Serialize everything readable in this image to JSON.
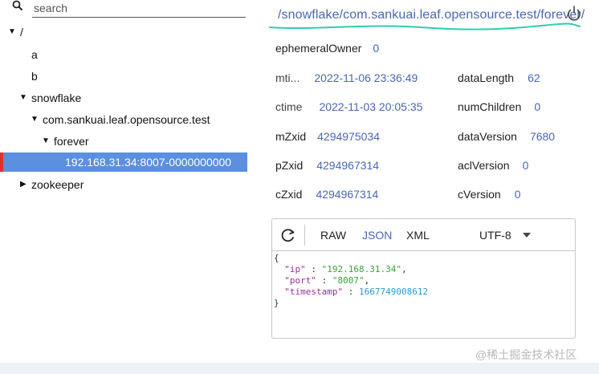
{
  "search": {
    "placeholder": "search"
  },
  "tree": {
    "root": "/",
    "a": "a",
    "b": "b",
    "snowflake": "snowflake",
    "com": "com.sankuai.leaf.opensource.test",
    "forever": "forever",
    "selected_node": "192.168.31.34:8007-0000000000",
    "zookeeper": "zookeeper"
  },
  "path": "/snowflake/com.sankuai.leaf.opensource.test/forever/",
  "props": {
    "ephemeralOwner": {
      "key": "ephemeralOwner",
      "value": "0"
    },
    "mtime": {
      "key": "mti...",
      "value": "2022-11-06 23:36:49"
    },
    "ctime": {
      "key": "ctime",
      "value": "2022-11-03 20:05:35"
    },
    "mZxid": {
      "key": "mZxid",
      "value": "4294975034"
    },
    "pZxid": {
      "key": "pZxid",
      "value": "4294967314"
    },
    "cZxid": {
      "key": "cZxid",
      "value": "4294967314"
    },
    "dataLength": {
      "key": "dataLength",
      "value": "62"
    },
    "numChildren": {
      "key": "numChildren",
      "value": "0"
    },
    "dataVersion": {
      "key": "dataVersion",
      "value": "7680"
    },
    "aclVersion": {
      "key": "aclVersion",
      "value": "0"
    },
    "cVersion": {
      "key": "cVersion",
      "value": "0"
    }
  },
  "viewer": {
    "tabs": {
      "raw": "RAW",
      "json": "JSON",
      "xml": "XML"
    },
    "active_tab": "JSON",
    "encoding": "UTF-8",
    "content": {
      "open": "{",
      "ip_key": "\"ip\"",
      "ip_val": "\"192.168.31.34\"",
      "port_key": "\"port\"",
      "port_val": "\"8007\"",
      "ts_key": "\"timestamp\"",
      "ts_val": "1667749008612",
      "close": "}"
    }
  },
  "watermark": "@稀土掘金技术社区",
  "colors": {
    "accent": "#4a67b5",
    "selection": "#5b8fdf",
    "selection_marker": "#e0322b",
    "underline": "#2ecfb0"
  }
}
